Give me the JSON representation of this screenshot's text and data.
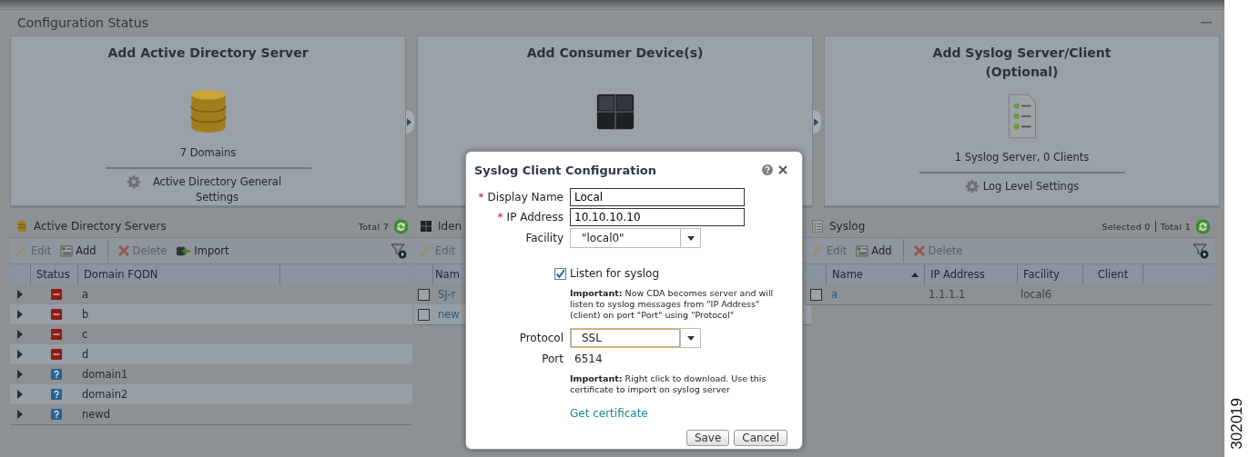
{
  "header": {
    "title": "Configuration Status"
  },
  "cards": [
    {
      "kind": "directory",
      "title": "Add Active Directory Server",
      "summary": "7 Domains",
      "settings": "Active Directory General Settings"
    },
    {
      "kind": "consumer",
      "title": "Add Consumer Device(s)"
    },
    {
      "kind": "syslog",
      "title": "Add Syslog Server/Client (Optional)",
      "summary": "1 Syslog Server, 0 Clients",
      "settings": "Log Level Settings"
    }
  ],
  "panels": [
    {
      "kind": "directory",
      "title": "Active Directory Servers",
      "counts": [
        "Total 7"
      ],
      "toolbar": [
        {
          "kind": "edit",
          "label": "Edit",
          "disabled": true
        },
        {
          "kind": "add",
          "label": "Add",
          "disabled": false
        },
        {
          "kind": "delete",
          "label": "Delete",
          "disabled": true
        },
        {
          "kind": "import",
          "label": "Import",
          "disabled": false
        }
      ],
      "columns": [
        {
          "label": "Status"
        },
        {
          "label": "Domain FQDN"
        }
      ],
      "rows": [
        {
          "kind": "error",
          "cells": [
            "a"
          ]
        },
        {
          "kind": "error",
          "cells": [
            "b"
          ]
        },
        {
          "kind": "error",
          "cells": [
            "c"
          ]
        },
        {
          "kind": "error",
          "cells": [
            "d"
          ]
        },
        {
          "kind": "unknown",
          "cells": [
            "domain1"
          ]
        },
        {
          "kind": "unknown",
          "cells": [
            "domain2"
          ]
        },
        {
          "kind": "unknown",
          "cells": [
            "newd"
          ]
        }
      ]
    },
    {
      "kind": "consumer",
      "title": "Iden",
      "toolbar": [
        {
          "kind": "edit",
          "label": "Edit",
          "disabled": true
        }
      ],
      "columns": [
        {
          "label": "Nam"
        }
      ],
      "rows": [
        {
          "checked": false,
          "cells": [
            "SJ-r"
          ]
        },
        {
          "checked": false,
          "cells": [
            "new"
          ]
        }
      ]
    },
    {
      "kind": "syslog",
      "title": "Syslog",
      "counts": [
        "Selected 0",
        "Total 1"
      ],
      "toolbar": [
        {
          "kind": "edit",
          "label": "Edit",
          "disabled": true
        },
        {
          "kind": "add",
          "label": "Add",
          "disabled": false
        },
        {
          "kind": "delete",
          "label": "Delete",
          "disabled": true
        }
      ],
      "columns": [
        {
          "label": "Name",
          "sorted": true
        },
        {
          "label": "IP Address"
        },
        {
          "label": "Facility"
        },
        {
          "label": "Client"
        }
      ],
      "rows": [
        {
          "checked": false,
          "cells": [
            "a",
            "1.1.1.1",
            "local6",
            ""
          ]
        }
      ]
    }
  ],
  "dialog": {
    "title": "Syslog Client Configuration",
    "fields": [
      {
        "kind": "text",
        "label": "Display Name",
        "required_mark": "*",
        "value": "Local"
      },
      {
        "kind": "text",
        "label": "IP Address",
        "required_mark": "*",
        "value": "10.10.10.10"
      },
      {
        "kind": "select",
        "label": "Facility",
        "value": "\"local0\"",
        "focused": false
      },
      {
        "kind": "checkbox",
        "label": "Listen for syslog",
        "checked": true
      },
      {
        "kind": "note",
        "text": "**Important:** Now CDA becomes server and will listen to syslog messages from \"IP Address\" (client) on port \"Port\" using \"Protocol\""
      },
      {
        "kind": "select",
        "label": "Protocol",
        "value": "SSL",
        "focused": true
      },
      {
        "kind": "static",
        "label": "Port",
        "value": "6514"
      },
      {
        "kind": "note",
        "text": "**Important:** Right click to download. Use this certificate to import on syslog server"
      },
      {
        "kind": "link",
        "text": "Get certificate"
      }
    ],
    "buttons": [
      "Save",
      "Cancel"
    ]
  },
  "figure_number": "302019"
}
